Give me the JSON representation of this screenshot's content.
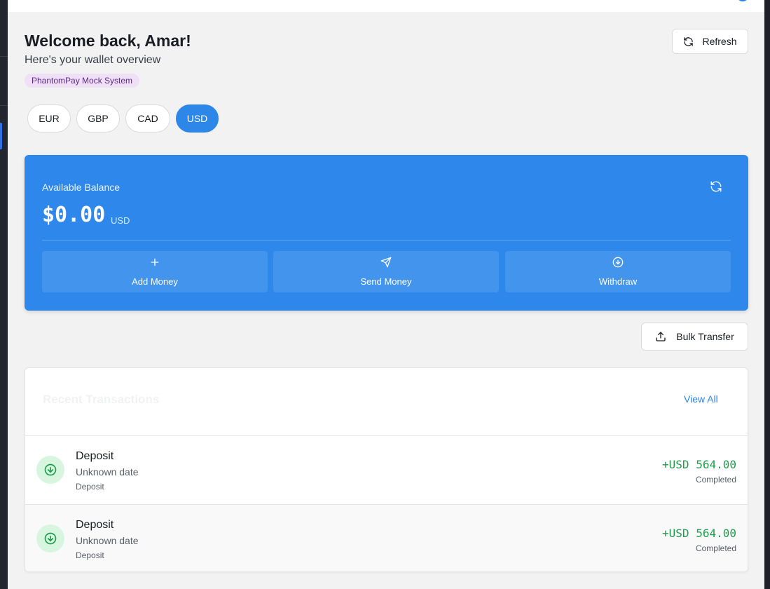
{
  "header": {
    "welcome": "Welcome back, Amar!",
    "subtitle": "Here's your wallet overview",
    "badge": "PhantomPay Mock System",
    "refresh_label": "Refresh"
  },
  "currencies": [
    {
      "code": "EUR",
      "active": false
    },
    {
      "code": "GBP",
      "active": false
    },
    {
      "code": "CAD",
      "active": false
    },
    {
      "code": "USD",
      "active": true
    }
  ],
  "balance": {
    "label": "Available Balance",
    "amount": "$0.00",
    "currency": "USD",
    "actions": [
      {
        "label": "Add Money",
        "icon": "plus-icon"
      },
      {
        "label": "Send Money",
        "icon": "send-icon"
      },
      {
        "label": "Withdraw",
        "icon": "arrow-down-circle-icon"
      }
    ]
  },
  "bulk_transfer_label": "Bulk Transfer",
  "transactions": {
    "title": "Recent Transactions",
    "view_all": "View All",
    "items": [
      {
        "name": "Deposit",
        "date": "Unknown date",
        "type": "Deposit",
        "amount": "+USD 564.00",
        "status": "Completed"
      },
      {
        "name": "Deposit",
        "date": "Unknown date",
        "type": "Deposit",
        "amount": "+USD 564.00",
        "status": "Completed"
      }
    ]
  },
  "colors": {
    "accent": "#2d87e8",
    "card": "#2e88eb",
    "positive": "#1f9d4c",
    "badge_bg": "#efe0f7"
  }
}
